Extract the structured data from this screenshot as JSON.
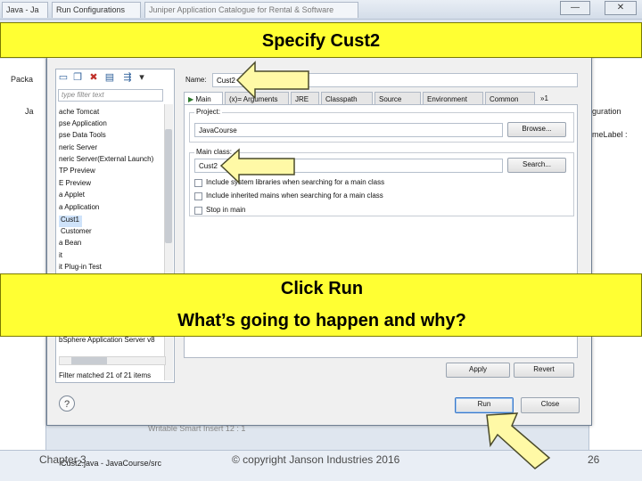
{
  "workbench": {
    "tabs": [
      "Java - Ja",
      "Run Configurations",
      "Juniper Application Catalogue for Rental & Software"
    ],
    "left_items": [
      "Packa",
      "Ja"
    ],
    "right_items": [
      "guration",
      "meLabel :"
    ],
    "status_text": "Cust2.java - JavaCourse/src",
    "status_text2": "Writable   Smart Insert   12 : 1"
  },
  "callouts": {
    "top": "Specify Cust2",
    "middle_line1": "Click Run",
    "middle_line2": "What’s going to happen and why?"
  },
  "dialog": {
    "filter_placeholder": "type filter text",
    "tree": [
      "ache Tomcat",
      "pse Application",
      "pse Data Tools",
      "neric Server",
      "neric Server(External Launch)",
      "TP Preview",
      "E Preview",
      "a Applet",
      "a Application",
      "Cust1",
      "Customer",
      "a Bean",
      "it",
      "it Plug-in Test",
      "bSphere Application Server v8"
    ],
    "filter_status": "Filter matched 21 of 21 items",
    "name_label": "Name:",
    "name_value": "Cust2",
    "tabs": [
      "Main",
      "(x)= Arguments",
      "JRE",
      "Classpath",
      "Source",
      "Environment",
      "»1"
    ],
    "project_label": "Project:",
    "project_value": "JavaCourse",
    "browse_label": "Browse...",
    "main_class_label": "Main class:",
    "main_class_value": "Cust2",
    "search_label": "Search...",
    "checkboxes": [
      "Include system libraries when searching for a main class",
      "Include inherited mains when searching for a main class",
      "Stop in main"
    ],
    "apply_label": "Apply",
    "revert_label": "Revert",
    "run_label": "Run",
    "close_label": "Close",
    "help_icon": "?"
  },
  "footer": {
    "chapter": "Chapter 3",
    "copyright": "© copyright Janson Industries 2016",
    "page": "26"
  },
  "colors": {
    "callout": "#ffff33",
    "arrow": "#fff9a6"
  }
}
